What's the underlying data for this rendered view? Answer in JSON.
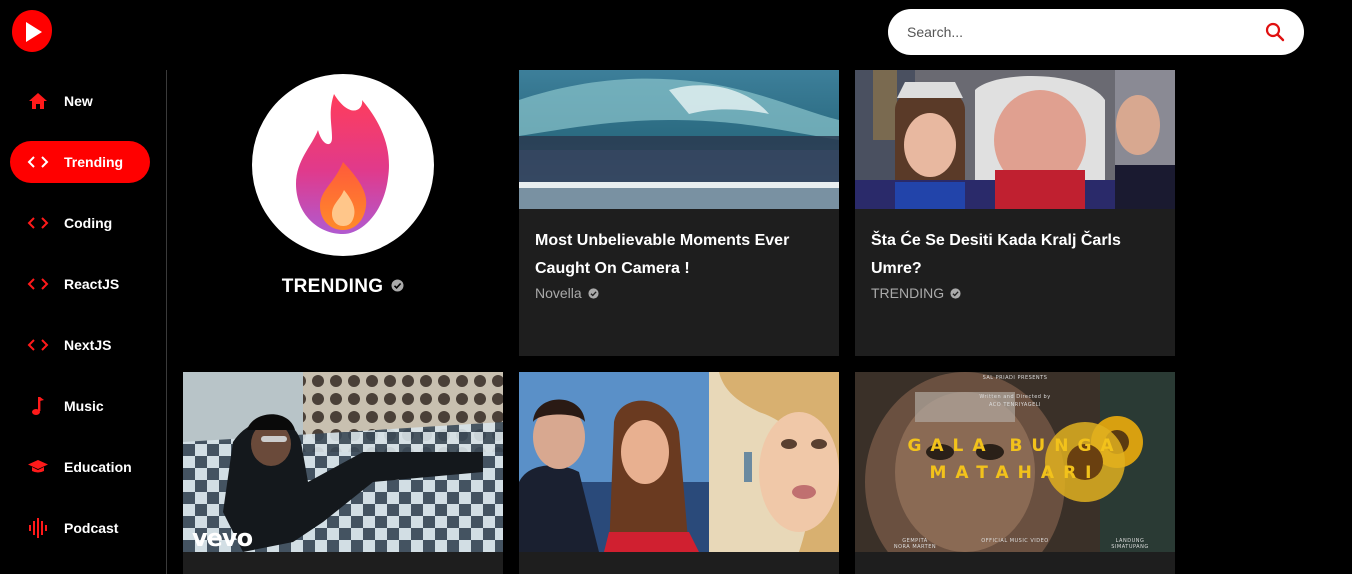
{
  "search": {
    "placeholder": "Search..."
  },
  "sidebar": {
    "items": [
      {
        "label": "New",
        "icon": "home-icon",
        "active": false
      },
      {
        "label": "Trending",
        "icon": "code-icon",
        "active": true
      },
      {
        "label": "Coding",
        "icon": "code-icon",
        "active": false
      },
      {
        "label": "ReactJS",
        "icon": "code-icon",
        "active": false
      },
      {
        "label": "NextJS",
        "icon": "code-icon",
        "active": false
      },
      {
        "label": "Music",
        "icon": "music-note-icon",
        "active": false
      },
      {
        "label": "Education",
        "icon": "graduation-cap-icon",
        "active": false
      },
      {
        "label": "Podcast",
        "icon": "podcast-waveform-icon",
        "active": false
      }
    ]
  },
  "channel": {
    "name": "TRENDING"
  },
  "videos": [
    {
      "title": "Most Unbelievable Moments Ever Caught On Camera !",
      "channel": "Novella"
    },
    {
      "title": "Šta Će Se Desiti Kada Kralj Čarls Umre?",
      "channel": "TRENDING"
    },
    {
      "thumb_text": "vevo"
    },
    {},
    {
      "thumb_top": "SAL PRIADI PRESENTS",
      "thumb_credit_1": "Written and Directed by",
      "thumb_credit_2": "ACO TENRIYAGELI",
      "thumb_title_1": "GALA BUNGA",
      "thumb_title_2": "MATAHARI",
      "thumb_bottom_left_1": "GEMPITA",
      "thumb_bottom_left_2": "NORA MARTEN",
      "thumb_bottom_center": "OFFICIAL MUSIC VIDEO",
      "thumb_bottom_right_1": "LANDUNG",
      "thumb_bottom_right_2": "SIMATUPANG"
    }
  ],
  "colors": {
    "accent": "#ff0000",
    "card_bg": "#1e1e1e",
    "background": "#000000"
  }
}
